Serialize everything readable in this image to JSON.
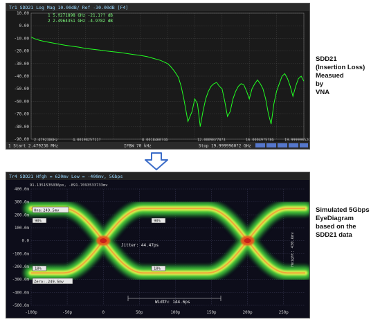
{
  "vna": {
    "header": "Tr1 SDD21 Log Mag 10.00dB/ Ref -30.00dB [F4]",
    "markers": [
      "1  5.0271898 GHz  -21.1??  dB",
      "2  2.4964351 GHz  -4.9?82  dB"
    ],
    "ytick_labels": [
      "10.00",
      "0.00",
      "-10.00",
      "-20.00",
      "-30.00",
      "-40.00",
      "-50.00",
      "-60.00",
      "-70.00",
      "-80.00",
      "-90.00"
    ],
    "xtick_labels": [
      "2.479238GHz",
      "4.0019825711?",
      "8.0018460?4G",
      "12.00098?78?3",
      "16.00049?5?8G",
      "19.99999652G"
    ],
    "status": [
      "1 Start 2.479236 MHz",
      "IFBW 70 kHz",
      "Stop 19.9999960?2 GHz"
    ],
    "chart_data": {
      "type": "line",
      "title": "",
      "xlabel": "",
      "ylabel": "",
      "xlim": [
        0,
        20
      ],
      "ylim": [
        -90,
        10
      ],
      "series": [
        {
          "name": "SDD21",
          "x": [
            0,
            0.3,
            0.6,
            1.0,
            1.5,
            2.0,
            2.5,
            3.0,
            3.5,
            4.0,
            4.5,
            5.0,
            5.5,
            6.0,
            6.5,
            7.0,
            7.5,
            8.0,
            8.5,
            9.0,
            9.5,
            10.0,
            10.2,
            10.5,
            10.8,
            11.0,
            11.2,
            11.5,
            11.8,
            12.0,
            12.2,
            12.4,
            12.6,
            12.8,
            13.0,
            13.2,
            13.4,
            13.6,
            13.8,
            14.0,
            14.2,
            14.4,
            14.6,
            14.8,
            15.0,
            15.2,
            15.4,
            15.6,
            15.8,
            16.0,
            16.2,
            16.4,
            16.6,
            16.8,
            17.0,
            17.2,
            17.4,
            17.6,
            17.8,
            18.0,
            18.2,
            18.4,
            18.6,
            18.8,
            19.0,
            19.2,
            19.4,
            19.6,
            19.8,
            20.0
          ],
          "y": [
            -9.0,
            -10.5,
            -11.5,
            -12.5,
            -13.5,
            -14.5,
            -15.5,
            -16.2,
            -17.0,
            -18.0,
            -18.6,
            -19.3,
            -20.0,
            -20.6,
            -21.2,
            -22.0,
            -22.8,
            -23.5,
            -24.5,
            -26.0,
            -27.5,
            -30.0,
            -32.0,
            -36.0,
            -41.0,
            -48.0,
            -58.0,
            -76.0,
            -68.0,
            -58.0,
            -62.0,
            -80.0,
            -68.0,
            -58.0,
            -52.0,
            -48.0,
            -46.0,
            -45.0,
            -48.0,
            -50.0,
            -60.0,
            -72.0,
            -68.0,
            -58.0,
            -52.0,
            -48.0,
            -46.0,
            -47.0,
            -52.0,
            -58.0,
            -50.0,
            -46.0,
            -43.0,
            -46.0,
            -50.0,
            -58.0,
            -70.0,
            -78.0,
            -62.0,
            -52.0,
            -46.0,
            -40.0,
            -38.0,
            -42.0,
            -48.0,
            -56.0,
            -48.0,
            -42.0,
            -40.0,
            -44.0
          ]
        }
      ]
    }
  },
  "eye": {
    "header": "Tr4 SDD21 Hfgh = 620mv Low = -400mv, 5Gbps",
    "marker_readout": "91.1351535036ps, -891.7093533733mv",
    "ytick_labels": [
      "400.0m",
      "300.0m",
      "200.0m",
      "100.0m",
      "0.0",
      "-100.0m",
      "-200.0m",
      "-300.0m",
      "-400.0m",
      "-500.0m"
    ],
    "xtick_labels": [
      "-100p",
      "-50p",
      "0",
      "50p",
      "100p",
      "150p",
      "200p",
      "250p"
    ],
    "annotations": {
      "level_high": "One:249.5mv",
      "level_low": "Zero:-249.5mv",
      "pct90": "90%",
      "pct10": "10%",
      "jitter": "Jitter: 44.47ps",
      "width": "Width: 144.6ps",
      "height_right": "Height: 430.6mv"
    },
    "chart_data": {
      "type": "heatmap",
      "title": "",
      "xlabel": "",
      "ylabel": "",
      "xlim": [
        -100,
        280
      ],
      "ylim": [
        -500,
        400
      ],
      "bit_period_ps": 200,
      "crossings_ps": [
        0,
        200
      ],
      "rails_mv": [
        249.5,
        -249.5
      ],
      "jitter_ps": 44.47,
      "eye_width_ps": 144.6
    }
  },
  "labels": {
    "vna_caption": [
      "SDD21",
      "(Insertion Loss)",
      "Measued",
      "by",
      "VNA"
    ],
    "eye_caption": [
      "Simulated 5Gbps",
      "EyeDiagram",
      "based on the",
      "SDD21 data"
    ]
  },
  "colors": {
    "trace": "#22ff22",
    "arrow": "#3b6cc8",
    "panel_bg": "#1a1a1a"
  }
}
